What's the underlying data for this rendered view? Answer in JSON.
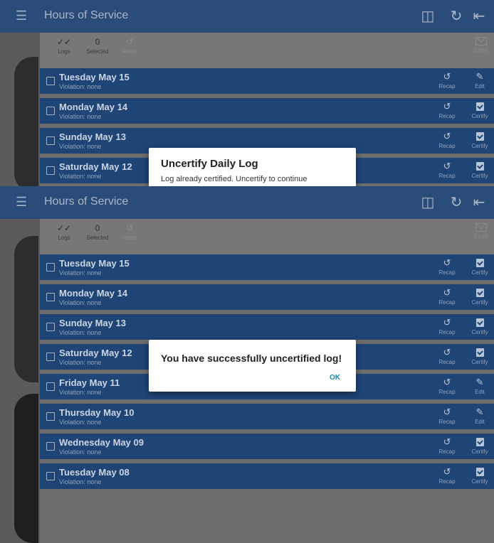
{
  "appbar": {
    "title": "Hours of Service",
    "menu_icon": "menu-icon",
    "actions": [
      "transfer-icon",
      "refresh-icon",
      "logout-icon"
    ]
  },
  "toolbar": {
    "logs_count_icon": "check-all-icon",
    "logs_label": "Logs",
    "selected_count": "0",
    "selected_label": "Selected",
    "reset_label": "Reset",
    "email_label": "Email"
  },
  "top_screen": {
    "rows": [
      {
        "day": "Tuesday May 15",
        "violation": "Violation: none",
        "recap": "Recap",
        "action": "Edit"
      },
      {
        "day": "Monday May 14",
        "violation": "Violation: none",
        "recap": "Recap",
        "action": "Certify"
      },
      {
        "day": "Sunday May 13",
        "violation": "Violation: none",
        "recap": "Recap",
        "action": "Certify"
      },
      {
        "day": "Saturday May 12",
        "violation": "Violation: none",
        "recap": "Recap",
        "action": "Certify"
      }
    ],
    "dialog": {
      "title": "Uncertify Daily Log",
      "message": "Log already certified. Uncertify to continue"
    }
  },
  "bottom_screen": {
    "rows": [
      {
        "day": "Tuesday May 15",
        "violation": "Violation: none",
        "recap": "Recap",
        "action": "Certify"
      },
      {
        "day": "Monday May 14",
        "violation": "Violation: none",
        "recap": "Recap",
        "action": "Certify"
      },
      {
        "day": "Sunday May 13",
        "violation": "Violation: none",
        "recap": "Recap",
        "action": "Certify"
      },
      {
        "day": "Saturday May 12",
        "violation": "Violation: none",
        "recap": "Recap",
        "action": "Certify"
      },
      {
        "day": "Friday May 11",
        "violation": "Violation: none",
        "recap": "Recap",
        "action": "Edit"
      },
      {
        "day": "Thursday May 10",
        "violation": "Violation: none",
        "recap": "Recap",
        "action": "Edit"
      },
      {
        "day": "Wednesday May 09",
        "violation": "Violation: none",
        "recap": "Recap",
        "action": "Certify"
      },
      {
        "day": "Tuesday May 08",
        "violation": "Violation: none",
        "recap": "Recap",
        "action": "Certify"
      }
    ],
    "dialog": {
      "title": "You have successfully uncertified log!",
      "ok_label": "OK"
    }
  },
  "colors": {
    "appbar": "#2a4c78",
    "row": "#1f4577",
    "ok_accent": "#1e88a8"
  }
}
